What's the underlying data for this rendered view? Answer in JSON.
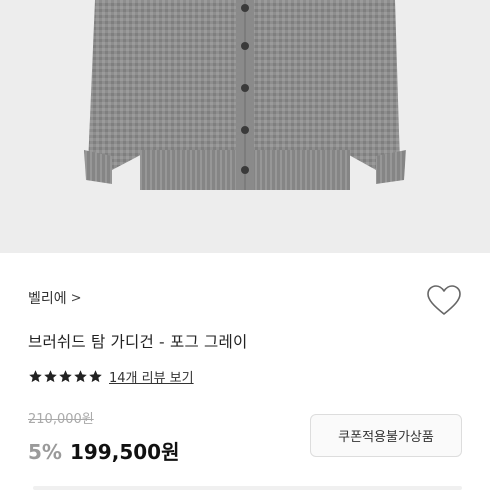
{
  "product": {
    "image_alt": "gray brushed cardigan",
    "brand": "벨리에",
    "brand_chevron": ">",
    "title": "브러쉬드 탐 가디건 - 포그 그레이",
    "rating_stars": 5,
    "review_link": "14개 리뷰 보기",
    "original_price": "210,000원",
    "discount": "5%",
    "price": "199,500원",
    "coupon_label": "쿠폰적용불가상품"
  },
  "colors": {
    "background": "#ffffff",
    "image_bg": "#ededed",
    "sweater": "#8d8d8d",
    "discount": "#9a9a9a",
    "original_price": "#aaaaaa"
  },
  "icons": {
    "wishlist": "heart-outline-icon",
    "star": "star-filled-icon"
  }
}
